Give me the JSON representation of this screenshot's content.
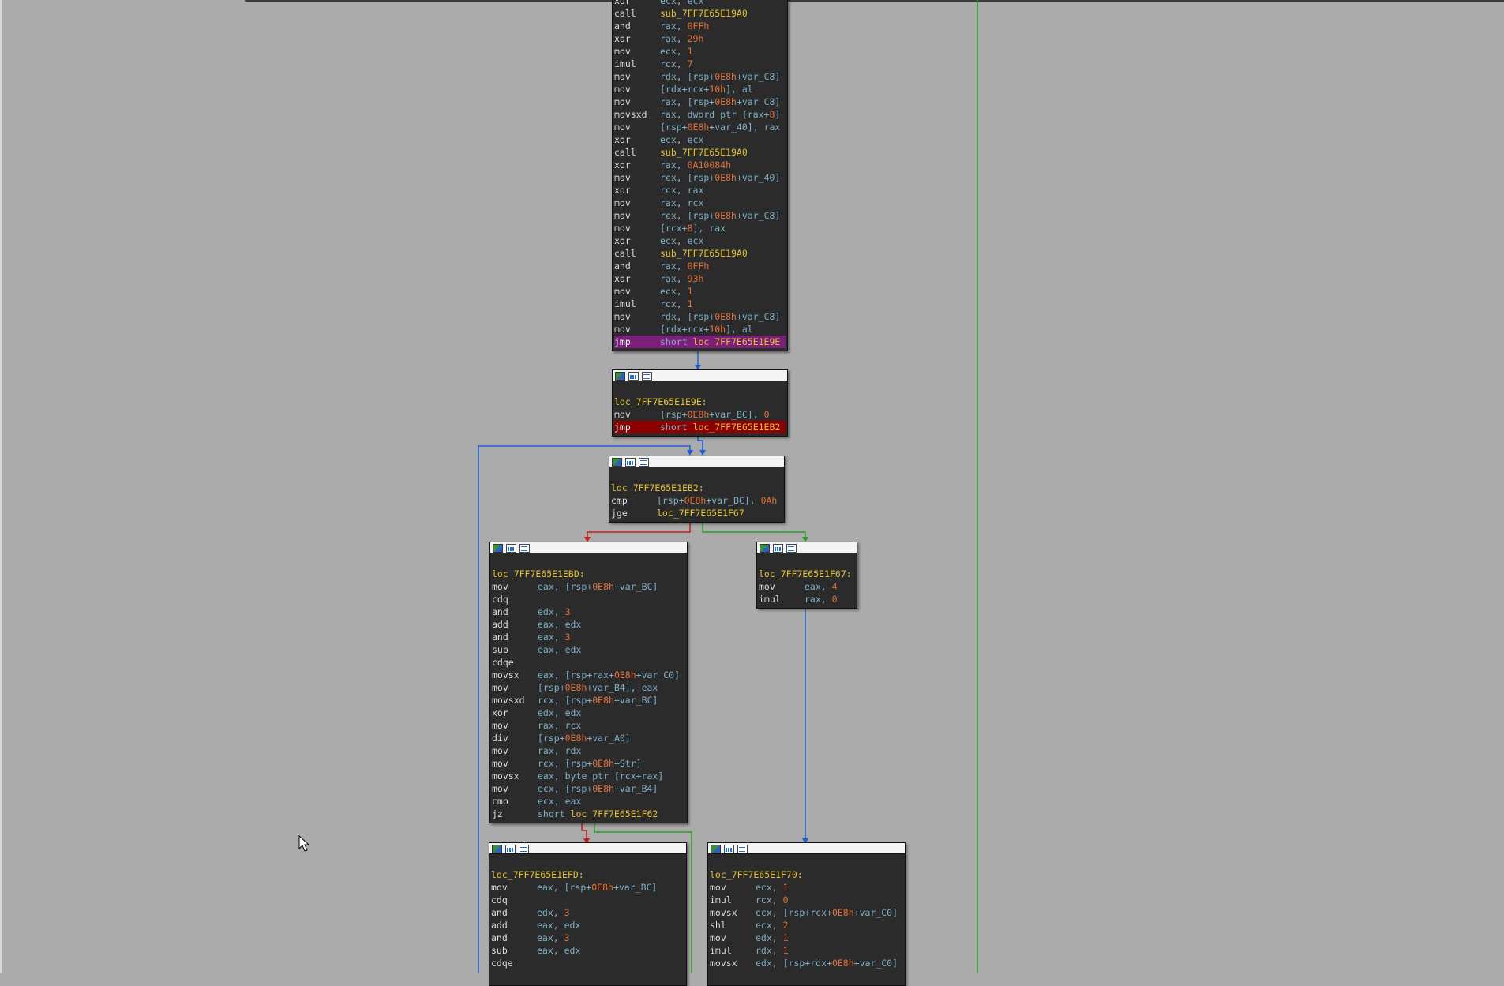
{
  "app": "IDA graph view",
  "blocks": {
    "top": {
      "label": "",
      "lines": [
        {
          "m": "xor",
          "o": "ecx, ecx"
        },
        {
          "m": "call",
          "o": "sub_7FF7E65E19A0"
        },
        {
          "m": "and",
          "o": "rax, 0FFh"
        },
        {
          "m": "xor",
          "o": "rax, 29h"
        },
        {
          "m": "mov",
          "o": "ecx, 1"
        },
        {
          "m": "imul",
          "o": "rcx, 7"
        },
        {
          "m": "mov",
          "o": "rdx, [rsp+0E8h+var_C8]"
        },
        {
          "m": "mov",
          "o": "[rdx+rcx+10h], al"
        },
        {
          "m": "mov",
          "o": "rax, [rsp+0E8h+var_C8]"
        },
        {
          "m": "movsxd",
          "o": "rax, dword ptr [rax+8]"
        },
        {
          "m": "mov",
          "o": "[rsp+0E8h+var_40], rax"
        },
        {
          "m": "xor",
          "o": "ecx, ecx"
        },
        {
          "m": "call",
          "o": "sub_7FF7E65E19A0"
        },
        {
          "m": "xor",
          "o": "rax, 0A10084h"
        },
        {
          "m": "mov",
          "o": "rcx, [rsp+0E8h+var_40]"
        },
        {
          "m": "xor",
          "o": "rcx, rax"
        },
        {
          "m": "mov",
          "o": "rax, rcx"
        },
        {
          "m": "mov",
          "o": "rcx, [rsp+0E8h+var_C8]"
        },
        {
          "m": "mov",
          "o": "[rcx+8], rax"
        },
        {
          "m": "xor",
          "o": "ecx, ecx"
        },
        {
          "m": "call",
          "o": "sub_7FF7E65E19A0"
        },
        {
          "m": "and",
          "o": "rax, 0FFh"
        },
        {
          "m": "xor",
          "o": "rax, 93h"
        },
        {
          "m": "mov",
          "o": "ecx, 1"
        },
        {
          "m": "imul",
          "o": "rcx, 1"
        },
        {
          "m": "mov",
          "o": "rdx, [rsp+0E8h+var_C8]"
        },
        {
          "m": "mov",
          "o": "[rdx+rcx+10h], al"
        },
        {
          "m": "jmp",
          "o": "short loc_7FF7E65E1E9E"
        }
      ]
    },
    "b1e9e": {
      "label": "loc_7FF7E65E1E9E:",
      "lines": [
        {
          "m": "mov",
          "o": "[rsp+0E8h+var_BC], 0"
        },
        {
          "m": "jmp",
          "o": "short loc_7FF7E65E1EB2"
        }
      ]
    },
    "b1eb2": {
      "label": "loc_7FF7E65E1EB2:",
      "lines": [
        {
          "m": "cmp",
          "o": "[rsp+0E8h+var_BC], 0Ah"
        },
        {
          "m": "jge",
          "o": "loc_7FF7E65E1F67"
        }
      ]
    },
    "b1ebd": {
      "label": "loc_7FF7E65E1EBD:",
      "lines": [
        {
          "m": "mov",
          "o": "eax, [rsp+0E8h+var_BC]"
        },
        {
          "m": "cdq",
          "o": ""
        },
        {
          "m": "and",
          "o": "edx, 3"
        },
        {
          "m": "add",
          "o": "eax, edx"
        },
        {
          "m": "and",
          "o": "eax, 3"
        },
        {
          "m": "sub",
          "o": "eax, edx"
        },
        {
          "m": "cdqe",
          "o": ""
        },
        {
          "m": "movsx",
          "o": "eax, [rsp+rax+0E8h+var_C0]"
        },
        {
          "m": "mov",
          "o": "[rsp+0E8h+var_B4], eax"
        },
        {
          "m": "movsxd",
          "o": "rcx, [rsp+0E8h+var_BC]"
        },
        {
          "m": "xor",
          "o": "edx, edx"
        },
        {
          "m": "mov",
          "o": "rax, rcx"
        },
        {
          "m": "div",
          "o": "[rsp+0E8h+var_A0]"
        },
        {
          "m": "mov",
          "o": "rax, rdx"
        },
        {
          "m": "mov",
          "o": "rcx, [rsp+0E8h+Str]"
        },
        {
          "m": "movsx",
          "o": "eax, byte ptr [rcx+rax]"
        },
        {
          "m": "mov",
          "o": "ecx, [rsp+0E8h+var_B4]"
        },
        {
          "m": "cmp",
          "o": "ecx, eax"
        },
        {
          "m": "jz",
          "o": "short loc_7FF7E65E1F62"
        }
      ]
    },
    "b1f67": {
      "label": "loc_7FF7E65E1F67:",
      "lines": [
        {
          "m": "mov",
          "o": "eax, 4"
        },
        {
          "m": "imul",
          "o": "rax, 0"
        }
      ]
    },
    "b1efd": {
      "label": "loc_7FF7E65E1EFD:",
      "lines": [
        {
          "m": "mov",
          "o": "eax, [rsp+0E8h+var_BC]"
        },
        {
          "m": "cdq",
          "o": ""
        },
        {
          "m": "and",
          "o": "edx, 3"
        },
        {
          "m": "add",
          "o": "eax, edx"
        },
        {
          "m": "and",
          "o": "eax, 3"
        },
        {
          "m": "sub",
          "o": "eax, edx"
        },
        {
          "m": "cdqe",
          "o": ""
        }
      ]
    },
    "b1f70": {
      "label": "loc_7FF7E65E1F70:",
      "lines": [
        {
          "m": "mov",
          "o": "ecx, 1"
        },
        {
          "m": "imul",
          "o": "rcx, 0"
        },
        {
          "m": "movsx",
          "o": "ecx, [rsp+rcx+0E8h+var_C0]"
        },
        {
          "m": "shl",
          "o": "ecx, 2"
        },
        {
          "m": "mov",
          "o": "edx, 1"
        },
        {
          "m": "imul",
          "o": "rdx, 1"
        },
        {
          "m": "movsx",
          "o": "edx, [rsp+rdx+0E8h+var_C0]"
        }
      ]
    }
  },
  "colors": {
    "background": "#ababab",
    "block": "#2b2b2b",
    "label": "#e6c12c",
    "number": "#e2703a",
    "edge_true": "#2a9d2a",
    "edge_false": "#c81e1e",
    "edge_uncond": "#1e5fd6",
    "current_jump": "#8b0000",
    "jump_highlight": "#7a1f7a"
  }
}
